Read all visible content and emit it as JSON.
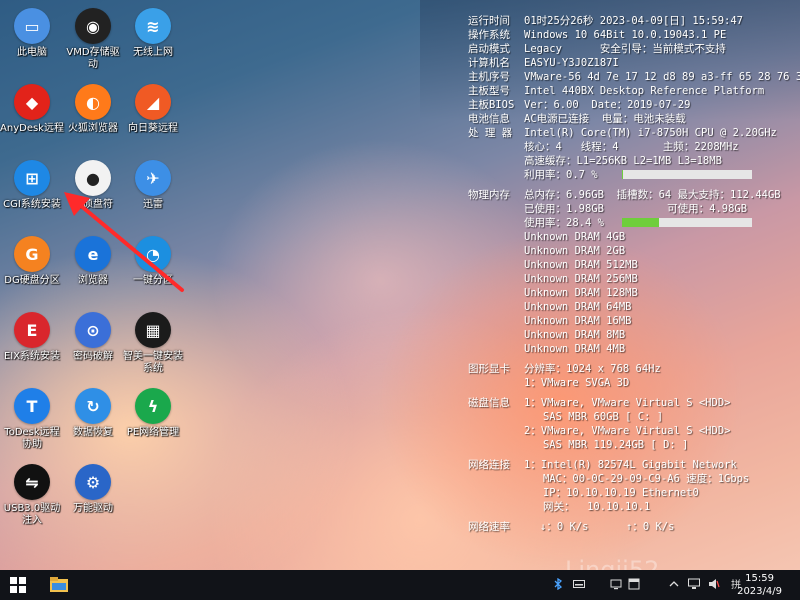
{
  "desktop": {
    "icons": [
      {
        "label": "此电脑",
        "icon": "computer-icon",
        "color": "#4a90e2"
      },
      {
        "label": "VMD存储驱\n动",
        "icon": "vmd-driver-icon",
        "color": "#222222"
      },
      {
        "label": "无线上网",
        "icon": "wifi-icon",
        "color": "#3aa0e8"
      },
      {
        "label": "AnyDesk远程",
        "icon": "anydesk-icon",
        "color": "#e2231a"
      },
      {
        "label": "火狐浏览器",
        "icon": "firefox-icon",
        "color": "#ff7a1a"
      },
      {
        "label": "向日葵远程",
        "icon": "sunlogin-icon",
        "color": "#f05a24"
      },
      {
        "label": "CGI系统安装",
        "icon": "windows-install-icon",
        "color": "#1e88e5"
      },
      {
        "label": "理硕盘符",
        "icon": "drive-letter-icon",
        "color": "#f2f2f2"
      },
      {
        "label": "迅雷",
        "icon": "thunder-icon",
        "color": "#3d8fe6"
      },
      {
        "label": "DG硬盘分区",
        "icon": "diskgenius-icon",
        "color": "#f58220"
      },
      {
        "label": "浏览器",
        "icon": "ie-browser-icon",
        "color": "#1a73d9"
      },
      {
        "label": "一键分区",
        "icon": "partition-icon",
        "color": "#1c8fe0"
      },
      {
        "label": "EIX系统安装",
        "icon": "eix-install-icon",
        "color": "#d9262c"
      },
      {
        "label": "密码破解",
        "icon": "password-crack-icon",
        "color": "#3b6fd8"
      },
      {
        "label": "智美一键安装\n系统",
        "icon": "install-system-icon",
        "color": "#1b1b1b"
      },
      {
        "label": "ToDesk远程\n协助",
        "icon": "todesk-icon",
        "color": "#1f7fe8"
      },
      {
        "label": "数据恢复",
        "icon": "data-recovery-icon",
        "color": "#2f8fe6"
      },
      {
        "label": "PE网络管理",
        "icon": "pe-network-icon",
        "color": "#1aa84c"
      },
      {
        "label": "USB3.0驱动\n注入",
        "icon": "usb-icon",
        "color": "#111111"
      },
      {
        "label": "万能驱动",
        "icon": "driver-gear-icon",
        "color": "#2a66c8"
      }
    ]
  },
  "sysinfo": {
    "uptime_key": "运行时间",
    "uptime_val": "01时25分26秒 2023-04-09[日] 15:59:47",
    "os_key": "操作系统",
    "os_val": "Windows 10 64Bit 10.0.19043.1 PE",
    "boot_key": "启动模式",
    "boot_val": "Legacy      安全引导：当前模式不支持",
    "name_key": "计算机名",
    "name_val": "EASYU-Y3J0Z187I",
    "mbsn_key": "主机序号",
    "mbsn_val": "VMware-56 4d 7e 17 12 d8 89 a3-ff 65 28 76 3",
    "mb_key": "主板型号",
    "mb_val": "Intel 440BX Desktop Reference Platform",
    "bios_key": "主板BIOS",
    "bios_val": "Ver：6.00  Date：2019-07-29",
    "batt_key": "电池信息",
    "batt_val": "AC电源已连接  电量：电池未装载",
    "cpu_key": "处 理 器",
    "cpu_val": "Intel(R) Core(TM) i7-8750H CPU @ 2.20GHz",
    "cpu_cores": "核心：4   线程：4       主频：2208MHz",
    "cpu_cache": "高速缓存：L1=256KB L2=1MB L3=18MB",
    "cpu_usage": "利用率：0.7 %",
    "cpu_usage_pct": 0.7,
    "mem_key": "物理内存",
    "mem_total": "总内存：6.96GB  插槽数：64 最大支持：112.44GB",
    "mem_used": "已使用：1.98GB          可使用：4.98GB",
    "mem_usage": "使用率：28.4 %",
    "mem_usage_pct": 28.4,
    "dram": [
      "Unknown DRAM 4GB",
      "Unknown DRAM 2GB",
      "Unknown DRAM 512MB",
      "Unknown DRAM 256MB",
      "Unknown DRAM 128MB",
      "Unknown DRAM 64MB",
      "Unknown DRAM 16MB",
      "Unknown DRAM 8MB",
      "Unknown DRAM 4MB"
    ],
    "gpu_key": "图形显卡",
    "gpu_res": "分辨率：1024 x 768 64Hz",
    "gpu_1": "1：VMware SVGA 3D",
    "disk_key": "磁盘信息",
    "disk_1a": "1：VMware, VMware Virtual S <HDD>",
    "disk_1b": "   SAS MBR 60GB [ C: ]",
    "disk_2a": "2：VMware, VMware Virtual S <HDD>",
    "disk_2b": "   SAS MBR 119.24GB [ D: ]",
    "net_key": "网络连接",
    "net_1": "1：Intel(R) 82574L Gigabit Network",
    "net_mac": "   MAC：00-0C-29-09-C9-A6 速度：1Gbps",
    "net_ip": "   IP：10.10.10.19 Ethernet0",
    "net_gw": "   网关：  10.10.10.1",
    "speed_key": "网络速率",
    "speed_down": "↓：0 K/s",
    "speed_up": "↑：0 K/s",
    "bar_color": "#6fce3c"
  },
  "taskbar": {
    "time": "15:59",
    "date": "2023/4/9",
    "watermark": "Lingji52"
  }
}
